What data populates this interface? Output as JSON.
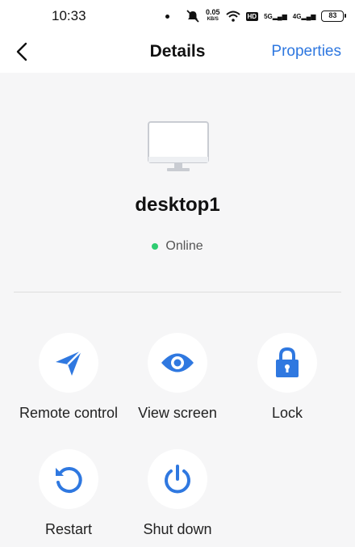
{
  "statusbar": {
    "time": "10:33",
    "speed_value": "0.05",
    "speed_unit": "KB/S",
    "hd_label": "HD",
    "signal_1": "5G",
    "signal_2": "4G",
    "battery": "83"
  },
  "navbar": {
    "title": "Details",
    "action_label": "Properties"
  },
  "device": {
    "name": "desktop1",
    "status": "Online",
    "status_color": "#2ecc71",
    "icon": "monitor-icon"
  },
  "actions": [
    {
      "label": "Remote control",
      "icon": "paper-plane-icon"
    },
    {
      "label": "View screen",
      "icon": "eye-icon"
    },
    {
      "label": "Lock",
      "icon": "lock-icon"
    },
    {
      "label": "Restart",
      "icon": "restart-icon"
    },
    {
      "label": "Shut down",
      "icon": "power-icon"
    }
  ],
  "colors": {
    "accent": "#2f78e0",
    "background": "#f6f6f7"
  }
}
